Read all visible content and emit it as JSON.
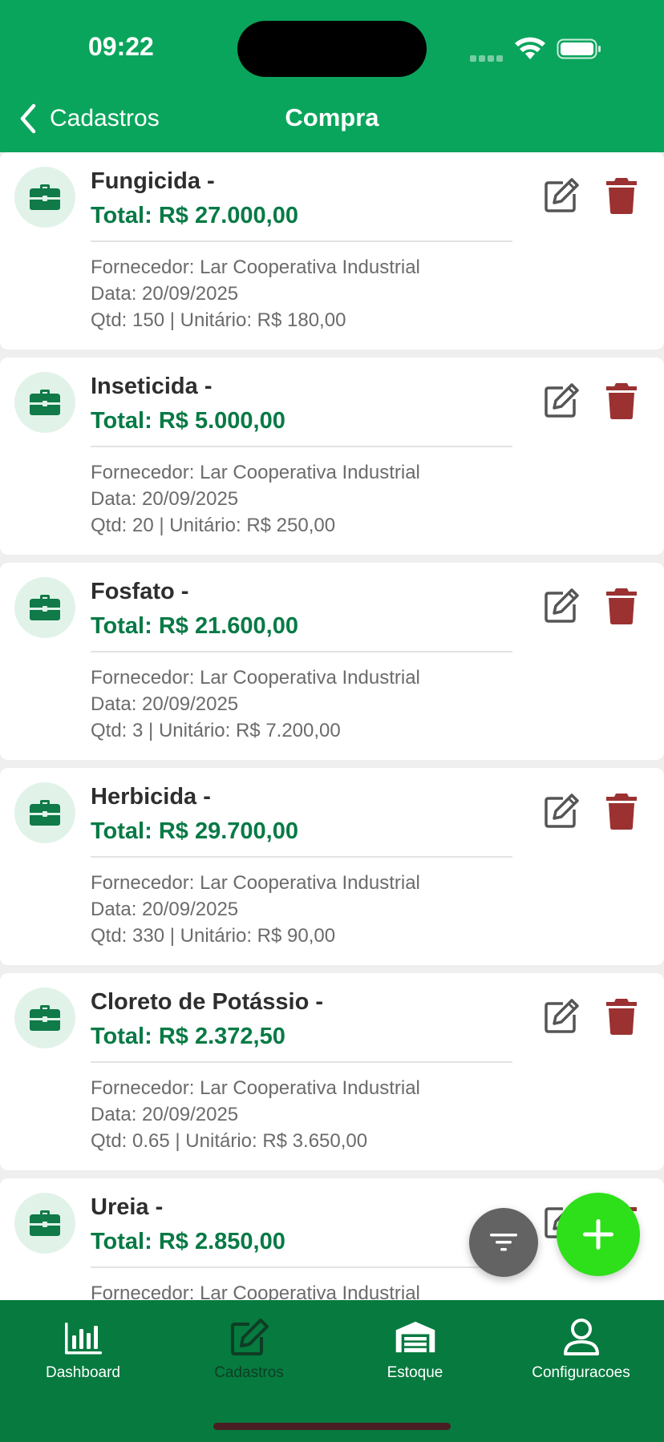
{
  "status_bar": {
    "time": "09:22"
  },
  "nav": {
    "back_label": "Cadastros",
    "title": "Compra"
  },
  "colors": {
    "header": "#0aa55c",
    "total_text": "#077a45",
    "delete": "#9b3131",
    "fab_add": "#2ee01a",
    "tabbar": "#067a3f"
  },
  "purchases": [
    {
      "title": "Fungicida -",
      "total": "Total: R$ 27.000,00",
      "fornecedor": "Fornecedor: Lar Cooperativa Industrial",
      "data": "Data: 20/09/2025",
      "qtd": "Qtd: 150 | Unitário: R$ 180,00"
    },
    {
      "title": "Inseticida -",
      "total": "Total: R$ 5.000,00",
      "fornecedor": "Fornecedor: Lar Cooperativa Industrial",
      "data": "Data: 20/09/2025",
      "qtd": "Qtd: 20 | Unitário: R$ 250,00"
    },
    {
      "title": "Fosfato -",
      "total": "Total: R$ 21.600,00",
      "fornecedor": "Fornecedor: Lar Cooperativa Industrial",
      "data": "Data: 20/09/2025",
      "qtd": "Qtd: 3 | Unitário: R$ 7.200,00"
    },
    {
      "title": "Herbicida -",
      "total": "Total: R$ 29.700,00",
      "fornecedor": "Fornecedor: Lar Cooperativa Industrial",
      "data": "Data: 20/09/2025",
      "qtd": "Qtd: 330 | Unitário: R$ 90,00"
    },
    {
      "title": "Cloreto de Potássio -",
      "total": "Total: R$ 2.372,50",
      "fornecedor": "Fornecedor: Lar Cooperativa Industrial",
      "data": "Data: 20/09/2025",
      "qtd": "Qtd: 0.65 | Unitário: R$ 3.650,00"
    },
    {
      "title": "Ureia -",
      "total": "Total: R$ 2.850,00",
      "fornecedor": "Fornecedor: Lar Cooperativa Industrial",
      "data": "",
      "qtd": ""
    }
  ],
  "tabs": [
    {
      "label": "Dashboard",
      "icon": "bar-chart-icon",
      "active": true
    },
    {
      "label": "Cadastros",
      "icon": "edit-icon",
      "active": false
    },
    {
      "label": "Estoque",
      "icon": "warehouse-icon",
      "active": true
    },
    {
      "label": "Configuracoes",
      "icon": "user-icon",
      "active": true
    }
  ]
}
